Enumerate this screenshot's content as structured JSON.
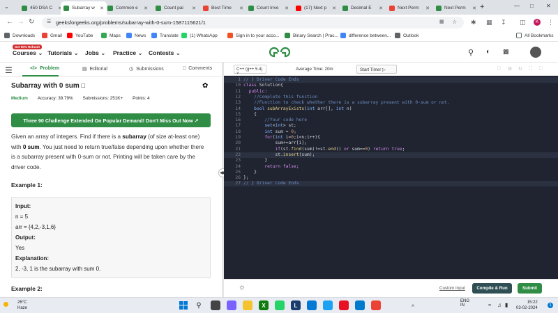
{
  "browser": {
    "tabs": [
      {
        "label": "450 DSA C",
        "active": false,
        "fav_color": "#2f8d46"
      },
      {
        "label": "Subarray w",
        "active": true,
        "fav_color": "#2f8d46"
      },
      {
        "label": "Common e",
        "active": false,
        "fav_color": "#2f8d46"
      },
      {
        "label": "Count pai",
        "active": false,
        "fav_color": "#2f8d46"
      },
      {
        "label": "Best Time",
        "active": false,
        "fav_color": "#ea4335"
      },
      {
        "label": "Count Inve",
        "active": false,
        "fav_color": "#2f8d46"
      },
      {
        "label": "(17) Next p",
        "active": false,
        "fav_color": "#ff0000"
      },
      {
        "label": "Decimal E",
        "active": false,
        "fav_color": "#2f8d46"
      },
      {
        "label": "Next Perm",
        "active": false,
        "fav_color": "#ea4335"
      },
      {
        "label": "Next Perm",
        "active": false,
        "fav_color": "#2f8d46"
      }
    ],
    "new_tab": "+",
    "url": "geeksforgeeks.org/problems/subarray-with-0-sum-1587115621/1",
    "profile_initial": "K",
    "bookmarks": [
      {
        "label": "Downloads",
        "color": "#5f6368"
      },
      {
        "label": "Gmail",
        "color": "#ea4335"
      },
      {
        "label": "YouTube",
        "color": "#ff0000"
      },
      {
        "label": "Maps",
        "color": "#34a853"
      },
      {
        "label": "News",
        "color": "#4285f4"
      },
      {
        "label": "Translate",
        "color": "#4285f4"
      },
      {
        "label": "(1) WhatsApp",
        "color": "#25d366"
      },
      {
        "label": "Sign in to your acco...",
        "color": "#f25022"
      },
      {
        "label": "Binary Search | Prac...",
        "color": "#2f8d46"
      },
      {
        "label": "difference between...",
        "color": "#4285f4"
      },
      {
        "label": "Outlook",
        "color": "#5f6368"
      }
    ],
    "all_bookmarks": "All Bookmarks"
  },
  "gfg": {
    "badge": "Get 90% Refund!",
    "menus": [
      "Courses",
      "Tutorials",
      "Jobs",
      "Practice",
      "Contests"
    ],
    "logo": "GG"
  },
  "problem_tabs": [
    "Problem",
    "Editorial",
    "Submissions",
    "Comments"
  ],
  "problem": {
    "title": "Subarray with 0 sum",
    "difficulty": "Medium",
    "accuracy": "Accuracy: 39.79%",
    "submissions": "Submissions: 251K+",
    "points": "Points: 4",
    "banner": "Three 90 Challenge Extended On Popular Demand! Don't Miss Out Now",
    "desc_1": "Given an array of integers. Find if there is a ",
    "desc_bold_1": "subarray",
    "desc_2": " (of size at-least one) with ",
    "desc_bold_2": "0 sum",
    "desc_3": ". You just need to return true/false depending upon whether there is a subarray present with 0-sum or not. Printing will be taken care by the driver code.",
    "example1_title": "Example 1:",
    "example1": {
      "input_label": "Input:",
      "n_line": "n = 5",
      "arr_line": "arr = {4,2,-3,1,6}",
      "output_label": "Output:",
      "output": "Yes",
      "explanation_label": "Explanation:",
      "explanation": "2, -3, 1 is the subarray with sum 0."
    },
    "example2_title": "Example 2:"
  },
  "editor": {
    "language": "C++ (g++ 5.4)",
    "avg_time": "Average Time: 20m",
    "start_timer": "Start Timer",
    "lines": [
      {
        "n": "1",
        "html": "<span class=\"cm\">// } Driver Code Ends</span>",
        "hl": true
      },
      {
        "n": "10",
        "html": "<span class=\"kw\">class</span> Solution{"
      },
      {
        "n": "11",
        "html": "  <span class=\"kw\">public</span>:"
      },
      {
        "n": "12",
        "html": "    <span class=\"cm\">//Complete this function</span>"
      },
      {
        "n": "13",
        "html": "    <span class=\"cm\">//Function to check whether there is a subarray present with 0-sum or not.</span>"
      },
      {
        "n": "14",
        "html": "    <span class=\"ty\">bool</span> <span class=\"fn\">subArrayExists</span>(<span class=\"ty\">int</span> arr[], <span class=\"ty\">int</span> n)"
      },
      {
        "n": "15",
        "html": "    {"
      },
      {
        "n": "16",
        "html": "        <span class=\"cm\">//Your code here</span>"
      },
      {
        "n": "17",
        "html": "        <span class=\"ty\">set</span>&lt;<span class=\"ty\">int</span>&gt; st;"
      },
      {
        "n": "18",
        "html": "        <span class=\"ty\">int</span> sum = <span class=\"nm\">0</span>;"
      },
      {
        "n": "19",
        "html": "        <span class=\"kw\">for</span>(<span class=\"ty\">int</span> i=<span class=\"nm\">0</span>;i&lt;n;i++){"
      },
      {
        "n": "20",
        "html": "            sum+=arr[i];"
      },
      {
        "n": "21",
        "html": "            <span class=\"kw\">if</span>(st.<span class=\"fn\">find</span>(sum)!=st.<span class=\"fn\">end</span>() <span class=\"kw\">or</span> sum==<span class=\"nm\">0</span>) <span class=\"kw\">return</span> <span class=\"kw\">true</span>;"
      },
      {
        "n": "22",
        "html": "            st.<span class=\"fn\">insert</span>(sum);",
        "hl": true
      },
      {
        "n": "23",
        "html": "        }"
      },
      {
        "n": "24",
        "html": "        <span class=\"kw\">return</span> <span class=\"kw\">false</span>;"
      },
      {
        "n": "25",
        "html": "    }"
      },
      {
        "n": "26",
        "html": "};"
      },
      {
        "n": "27",
        "html": "<span class=\"cm\">// } Driver Code Ends</span>",
        "hl": true
      }
    ],
    "custom_input": "Custom Input",
    "compile_run": "Compile & Run",
    "submit": "Submit"
  },
  "taskbar": {
    "temp": "26°C",
    "weather": "Haze",
    "lang_1": "ENG",
    "lang_2": "IN",
    "time": "15:22",
    "date": "03-02-2024"
  }
}
